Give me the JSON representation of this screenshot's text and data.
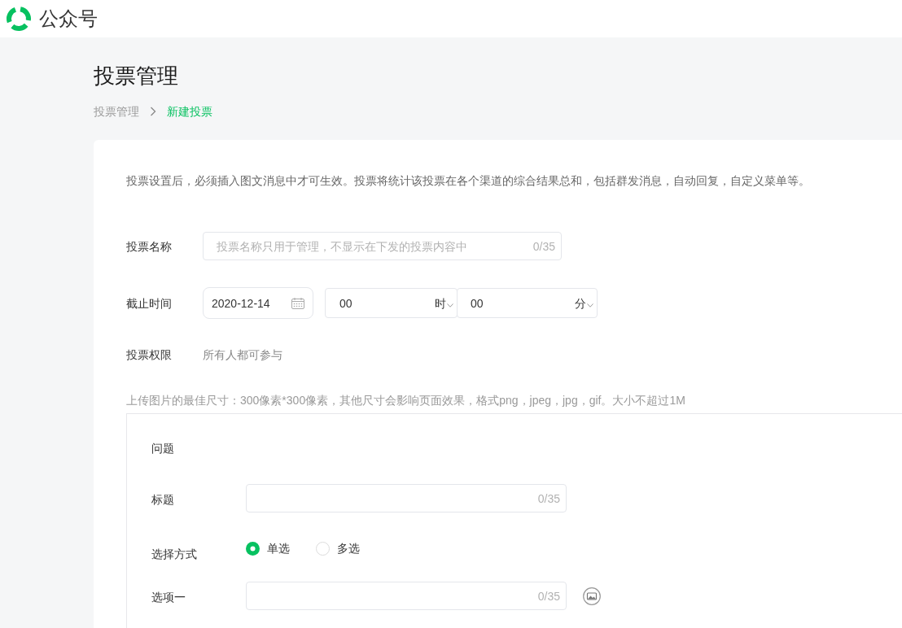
{
  "header": {
    "app_name": "公众号"
  },
  "page": {
    "title": "投票管理",
    "breadcrumb": [
      {
        "label": "投票管理",
        "selected": false
      },
      {
        "label": "新建投票",
        "selected": true
      }
    ]
  },
  "notice": "投票设置后，必须插入图文消息中才可生效。投票将统计该投票在各个渠道的综合结果总和，包括群发消息，自动回复，自定义菜单等。",
  "form": {
    "vote_name": {
      "label": "投票名称",
      "placeholder": "投票名称只用于管理，不显示在下发的投票内容中",
      "counter": "0/35"
    },
    "deadline": {
      "label": "截止时间",
      "date": "2020-12-14",
      "hour": "00",
      "hour_unit": "时",
      "minute": "00",
      "minute_unit": "分"
    },
    "permission": {
      "label": "投票权限",
      "value": "所有人都可参与"
    },
    "upload_hint": "上传图片的最佳尺寸：300像素*300像素，其他尺寸会影响页面效果，格式png，jpeg，jpg，gif。大小不超过1M",
    "question": {
      "heading": "问题",
      "title": {
        "label": "标题",
        "counter": "0/35"
      },
      "selection_mode": {
        "label": "选择方式",
        "options": [
          {
            "label": "单选",
            "selected": true
          },
          {
            "label": "多选",
            "selected": false
          }
        ]
      },
      "options": [
        {
          "label": "选项一",
          "counter": "0/35"
        }
      ]
    }
  }
}
